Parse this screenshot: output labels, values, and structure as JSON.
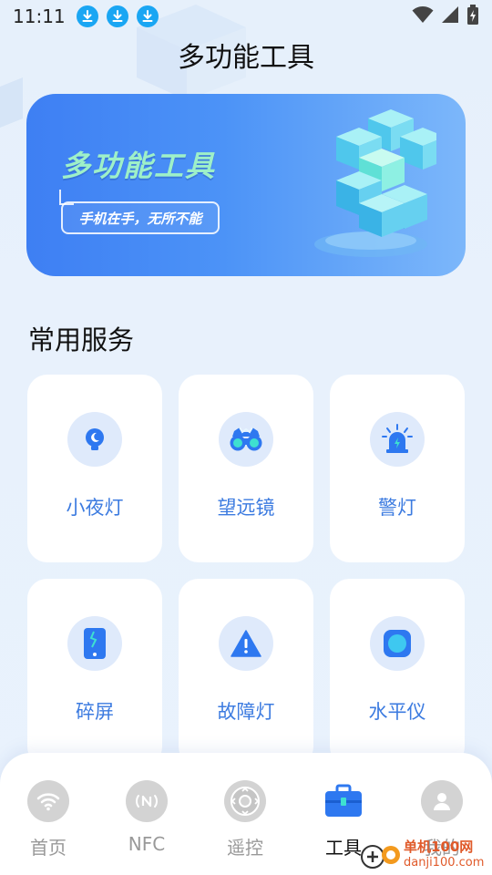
{
  "status_bar": {
    "time": "11:11",
    "download_count": 3
  },
  "page": {
    "title": "多功能工具"
  },
  "banner": {
    "title": "多功能工具",
    "slogan": "手机在手，无所不能"
  },
  "section": {
    "title": "常用服务"
  },
  "services": [
    {
      "label": "小夜灯",
      "icon": "night-light-icon"
    },
    {
      "label": "望远镜",
      "icon": "binoculars-icon"
    },
    {
      "label": "警灯",
      "icon": "siren-icon"
    },
    {
      "label": "碎屏",
      "icon": "broken-screen-icon"
    },
    {
      "label": "故障灯",
      "icon": "warning-triangle-icon"
    },
    {
      "label": "水平仪",
      "icon": "level-icon"
    }
  ],
  "tabs": [
    {
      "label": "首页",
      "icon": "wifi-icon",
      "active": false
    },
    {
      "label": "NFC",
      "icon": "nfc-icon",
      "active": false
    },
    {
      "label": "遥控",
      "icon": "remote-icon",
      "active": false
    },
    {
      "label": "工具",
      "icon": "toolbox-icon",
      "active": true
    },
    {
      "label": "我的",
      "icon": "user-icon",
      "active": false
    }
  ],
  "watermark": {
    "line1": "单机100网",
    "line2": "danji100.com"
  },
  "colors": {
    "accent": "#3c7be0",
    "icon_bg": "#dfeafb",
    "banner_start": "#3e7ff3",
    "banner_end": "#7cb7fa",
    "tab_inactive": "#d3d3d3",
    "download_badge": "#1aa6f3"
  }
}
